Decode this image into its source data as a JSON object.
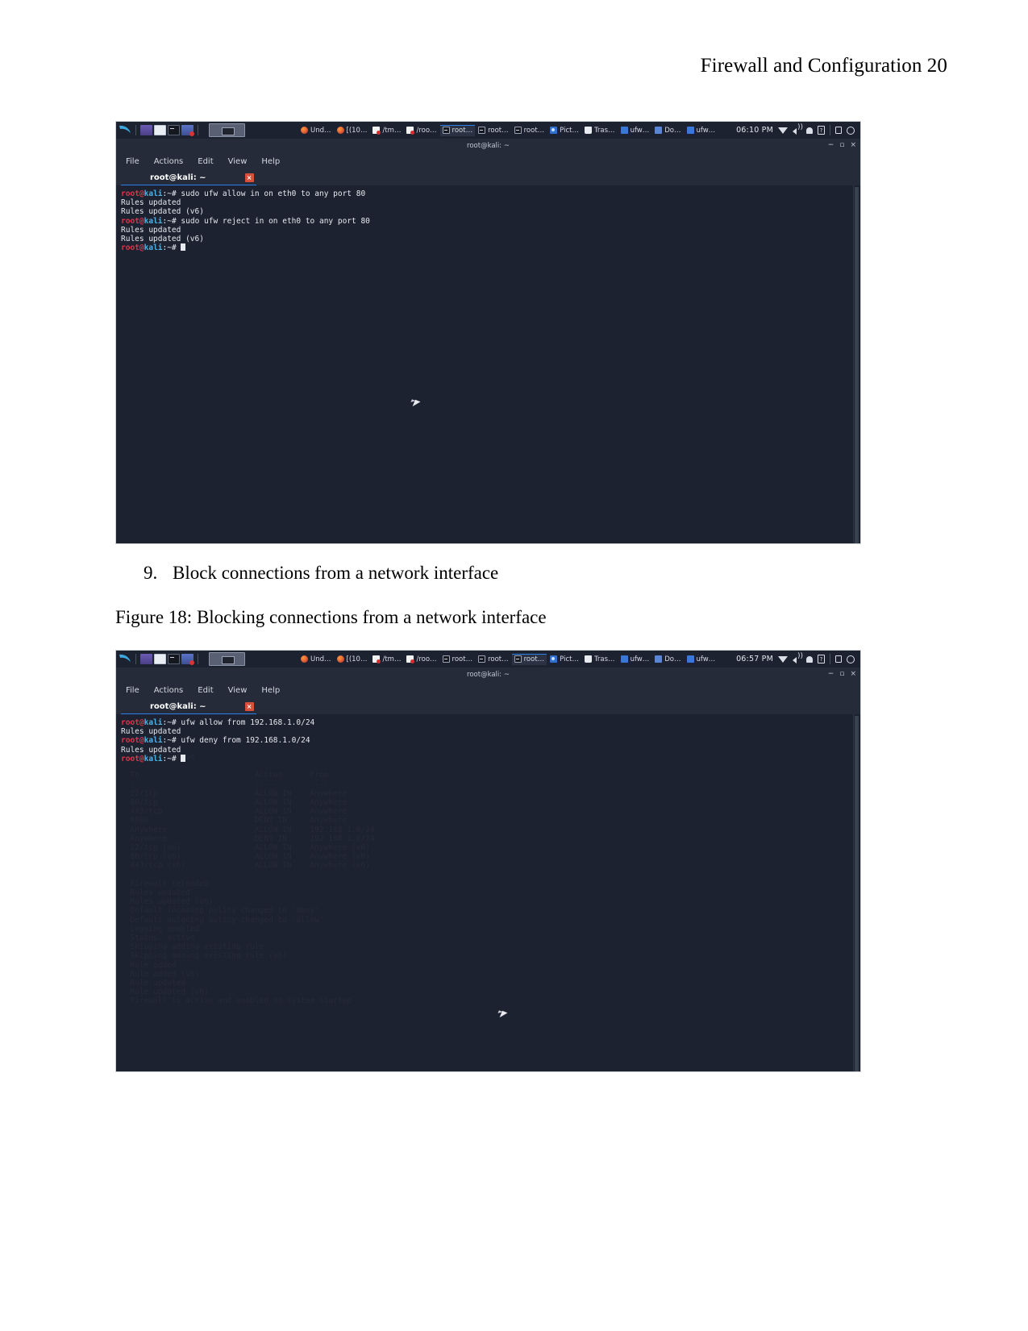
{
  "document": {
    "header": "Firewall and Configuration 20",
    "list_item": {
      "number": "9.",
      "text": "Block connections from a network interface"
    },
    "caption": "Figure 18: Blocking connections from a network interface"
  },
  "taskbar": {
    "launchers": [
      "kali-menu",
      "files-purple",
      "file-manager",
      "terminal",
      "network"
    ],
    "tasks": [
      {
        "icon": "firefox-icon",
        "label": "Und…"
      },
      {
        "icon": "firefox-icon",
        "label": "[(10…"
      },
      {
        "icon": "pdf-icon",
        "label": "/tm…"
      },
      {
        "icon": "pdf-icon",
        "label": "/roo…"
      },
      {
        "icon": "terminal-icon",
        "label": "root…"
      },
      {
        "icon": "terminal-icon",
        "label": "root…"
      },
      {
        "icon": "terminal-icon",
        "label": "root…"
      },
      {
        "icon": "image-icon",
        "label": "Pict…"
      },
      {
        "icon": "trash-icon",
        "label": "Tras…"
      },
      {
        "icon": "folder-icon",
        "label": "ufw…"
      },
      {
        "icon": "document-icon",
        "label": "Do…"
      },
      {
        "icon": "folder-icon",
        "label": "ufw…"
      }
    ],
    "tray": [
      "wifi-icon",
      "volume-icon",
      "notification-bell-icon",
      "battery-icon",
      "lock-icon",
      "power-icon"
    ],
    "clock_1": "06:10 PM",
    "clock_2": "06:57 PM"
  },
  "window": {
    "title": "root@kali: ~",
    "menu": [
      "File",
      "Actions",
      "Edit",
      "View",
      "Help"
    ],
    "tab_label": "root@kali: ~",
    "tab_close": "×",
    "minimize": "−",
    "maximize": "▫",
    "close": "×"
  },
  "terminal_1": {
    "lines": [
      {
        "type": "prompt",
        "user": "root",
        "at": "@",
        "host": "kali",
        "tail": ":~# ",
        "cmd": "sudo ufw allow in on eth0 to any port 80"
      },
      {
        "type": "out",
        "text": "Rules updated"
      },
      {
        "type": "out",
        "text": "Rules updated (v6)"
      },
      {
        "type": "prompt",
        "user": "root",
        "at": "@",
        "host": "kali",
        "tail": ":~# ",
        "cmd": "sudo ufw reject in on eth0 to any port 80"
      },
      {
        "type": "out",
        "text": "Rules updated"
      },
      {
        "type": "out",
        "text": "Rules updated (v6)"
      },
      {
        "type": "cursor",
        "user": "root",
        "at": "@",
        "host": "kali",
        "tail": ":~# "
      }
    ]
  },
  "terminal_2": {
    "lines": [
      {
        "type": "prompt",
        "user": "root",
        "at": "@",
        "host": "kali",
        "tail": ":~# ",
        "cmd": "ufw allow from 192.168.1.0/24"
      },
      {
        "type": "out",
        "text": "Rules updated"
      },
      {
        "type": "prompt",
        "user": "root",
        "at": "@",
        "host": "kali",
        "tail": ":~# ",
        "cmd": "ufw deny from 192.168.1.0/24"
      },
      {
        "type": "out",
        "text": "Rules updated"
      },
      {
        "type": "cursor",
        "user": "root",
        "at": "@",
        "host": "kali",
        "tail": ":~# "
      }
    ]
  },
  "colors": {
    "taskbar_bg": "#1c2230",
    "terminal_bg": "#1d2230",
    "prompt_red": "#e0334a",
    "prompt_blue": "#4fb0e8",
    "accent_blue": "#2b7fe8",
    "close_red": "#d94f3d"
  }
}
